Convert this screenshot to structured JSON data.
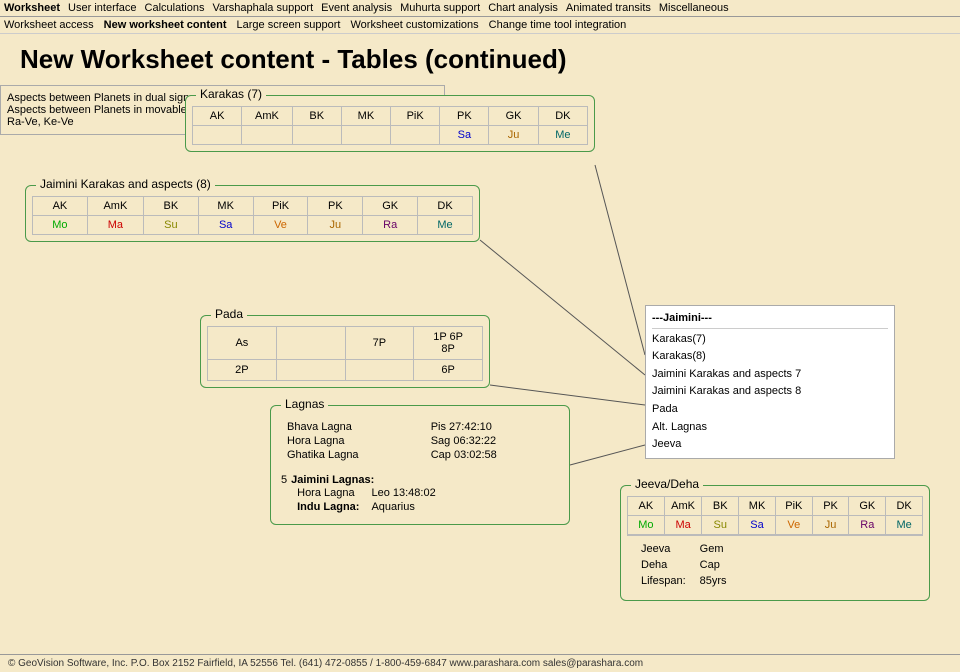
{
  "topNav": {
    "items": [
      {
        "label": "Worksheet",
        "bold": true
      },
      {
        "label": "User interface"
      },
      {
        "label": "Calculations"
      },
      {
        "label": "Varshaphala support"
      },
      {
        "label": "Event analysis"
      },
      {
        "label": "Muhurta support"
      },
      {
        "label": "Chart analysis"
      },
      {
        "label": "Animated transits"
      },
      {
        "label": "Miscellaneous"
      }
    ]
  },
  "secondNav": {
    "items": [
      {
        "label": "Worksheet access"
      },
      {
        "label": "New worksheet content",
        "active": true
      },
      {
        "label": "Large screen support"
      },
      {
        "label": "Worksheet customizations"
      },
      {
        "label": "Change time tool integration"
      }
    ]
  },
  "pageTitle": "New Worksheet content - Tables (continued)",
  "karakas7": {
    "label": "Karakas (7)",
    "headers": [
      "AK",
      "AmK",
      "BK",
      "MK",
      "PiK",
      "PK",
      "GK",
      "DK"
    ],
    "row2": [
      "",
      "",
      "",
      "",
      "",
      "Sa",
      "Ju",
      "Me"
    ]
  },
  "jaimini": {
    "label": "Jaimini Karakas and aspects (8)",
    "headers": [
      "AK",
      "AmK",
      "BK",
      "MK",
      "PiK",
      "PK",
      "GK",
      "DK"
    ],
    "row": [
      "Mo",
      "Ma",
      "Su",
      "Sa",
      "Ve",
      "Ju",
      "Ra",
      "Me"
    ],
    "rowColors": [
      "mo",
      "ma",
      "su",
      "sa",
      "ve",
      "ju",
      "ra",
      "me"
    ],
    "aspects1": "Aspects between Planets in dual signs: Mo-Ma-Ju-Sa",
    "aspects2": "Aspects between Planets in movable and fixed signs:",
    "aspects3": "Ra-Ve, Ke-Ve"
  },
  "pada": {
    "label": "Pada",
    "cells": [
      {
        "row": 0,
        "col": 0,
        "val": "As"
      },
      {
        "row": 0,
        "col": 2,
        "val": "7P"
      },
      {
        "row": 0,
        "col": 3,
        "val": "1P 6P\n8P"
      },
      {
        "row": 1,
        "col": 0,
        "val": "2P"
      },
      {
        "row": 1,
        "col": 3,
        "val": "6P"
      }
    ]
  },
  "lagnas": {
    "label": "Lagnas",
    "rows": [
      {
        "name": "Bhava Lagna",
        "value": "Pis 27:42:10"
      },
      {
        "name": "Hora Lagna",
        "value": "Sag 06:32:22"
      },
      {
        "name": "Ghatika Lagna",
        "value": "Cap 03:02:58"
      }
    ],
    "jaiminiLabel": "Jaimini Lagnas:",
    "jaiminiRows": [
      {
        "name": "Hora Lagna",
        "value": "Leo 13:48:02"
      },
      {
        "name": "Indu Lagna:",
        "value": "Aquarius"
      }
    ],
    "extraLabel": "5"
  },
  "menuBox": {
    "title": "---Jaimini---",
    "items": [
      "Karakas(7)",
      "Karakas(8)",
      "Jaimini Karakas and aspects 7",
      "Jaimini Karakas and aspects 8",
      "Pada",
      "Alt. Lagnas",
      "Jeeva"
    ]
  },
  "jeeva": {
    "label": "Jeeva/Deha",
    "headers": [
      "AK",
      "AmK",
      "BK",
      "MK",
      "PiK",
      "PK",
      "GK",
      "DK"
    ],
    "row": [
      "Mo",
      "Ma",
      "Su",
      "Sa",
      "Ve",
      "Ju",
      "Ra",
      "Me"
    ],
    "rowColors": [
      "mo",
      "ma",
      "su",
      "sa",
      "ve",
      "ju",
      "ra",
      "me"
    ],
    "info": [
      {
        "name": "Jeeva",
        "value": "Gem"
      },
      {
        "name": "Deha",
        "value": "Cap"
      },
      {
        "name": "Lifespan:",
        "value": "85yrs"
      }
    ]
  },
  "footer": {
    "text": "© GeoVision Software, Inc. P.O. Box 2152 Fairfield, IA 52556    Tel. (641) 472-0855 / 1-800-459-6847    www.parashara.com    sales@parashara.com"
  }
}
